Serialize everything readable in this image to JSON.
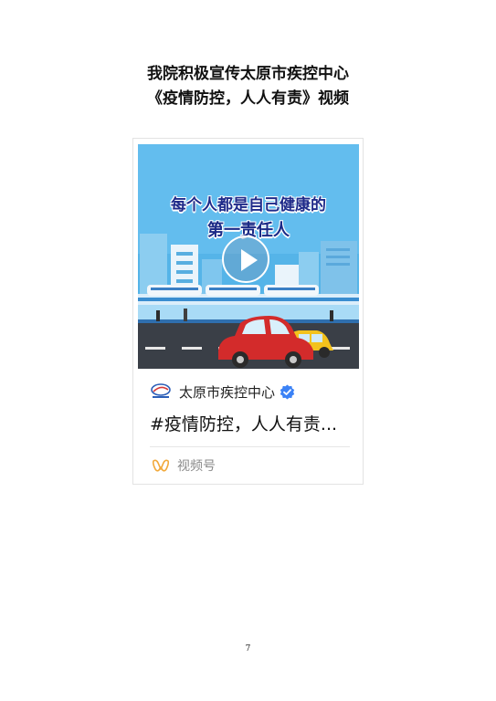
{
  "document": {
    "title_line1": "我院积极宣传太原市疾控中心",
    "title_line2": "《疫情防控，人人有责》视频",
    "page_number": "7"
  },
  "video_card": {
    "cover_text_line1": "每个人都是自己健康的",
    "cover_text_line2": "第一责任人",
    "channel_name": "太原市疾控中心",
    "post_title": "#疫情防控，人人有责...",
    "footer_label": "视频号",
    "icons": {
      "play": "play-icon",
      "logo": "cdc-logo-icon",
      "verified": "verified-badge-icon",
      "channels": "wechat-channels-icon"
    },
    "colors": {
      "sky": "#4fb0e6",
      "headline": "#1f2b8a",
      "verified": "#3b82f6",
      "channels_icon": "#f2a93b",
      "car_red": "#d32b2b",
      "car_yellow": "#f3c21c"
    }
  }
}
